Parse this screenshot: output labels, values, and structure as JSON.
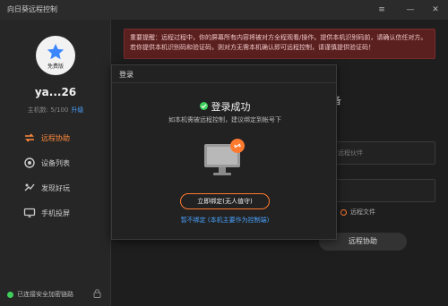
{
  "app": {
    "title": "向日葵远程控制"
  },
  "window_controls": {
    "menu": "≡",
    "minimize": "—",
    "close": "✕"
  },
  "sidebar": {
    "avatar_badge": "免费版",
    "username": "ya...26",
    "host_count": "主机数: 5/100",
    "upgrade": "升级",
    "items": [
      {
        "label": "远程协助",
        "icon": "remote-assist-icon",
        "active": true
      },
      {
        "label": "设备列表",
        "icon": "device-list-icon",
        "active": false
      },
      {
        "label": "发现好玩",
        "icon": "discover-icon",
        "active": false
      },
      {
        "label": "手机投屏",
        "icon": "phone-cast-icon",
        "active": false
      }
    ],
    "status": "已连接安全加密链路"
  },
  "main": {
    "notice": "重要提醒：远程过程中，你的屏幕所有内容将被对方全程观看/操作。提供本机识别码前，请确认信任对方。若你提供本机识别码和验证码，则对方无需本机确认即可远程控制，请谨慎提供验证码！",
    "heading_partial": "备",
    "input_placeholder": "远程伙伴",
    "radio_label": "远程文件",
    "connect_button": "远程协助"
  },
  "dialog": {
    "title": "登录",
    "success": "登录成功",
    "subtitle": "如本机需被远程控制，建议绑定到帐号下",
    "bind_button": "立即绑定(无人值守)",
    "skip_link": "暂不绑定 (本机主要作为控制端)"
  },
  "colors": {
    "accent": "#ff7a2f",
    "link": "#4aa3ff",
    "success": "#3ecf5a",
    "notice_bg": "#5a1f1f"
  }
}
